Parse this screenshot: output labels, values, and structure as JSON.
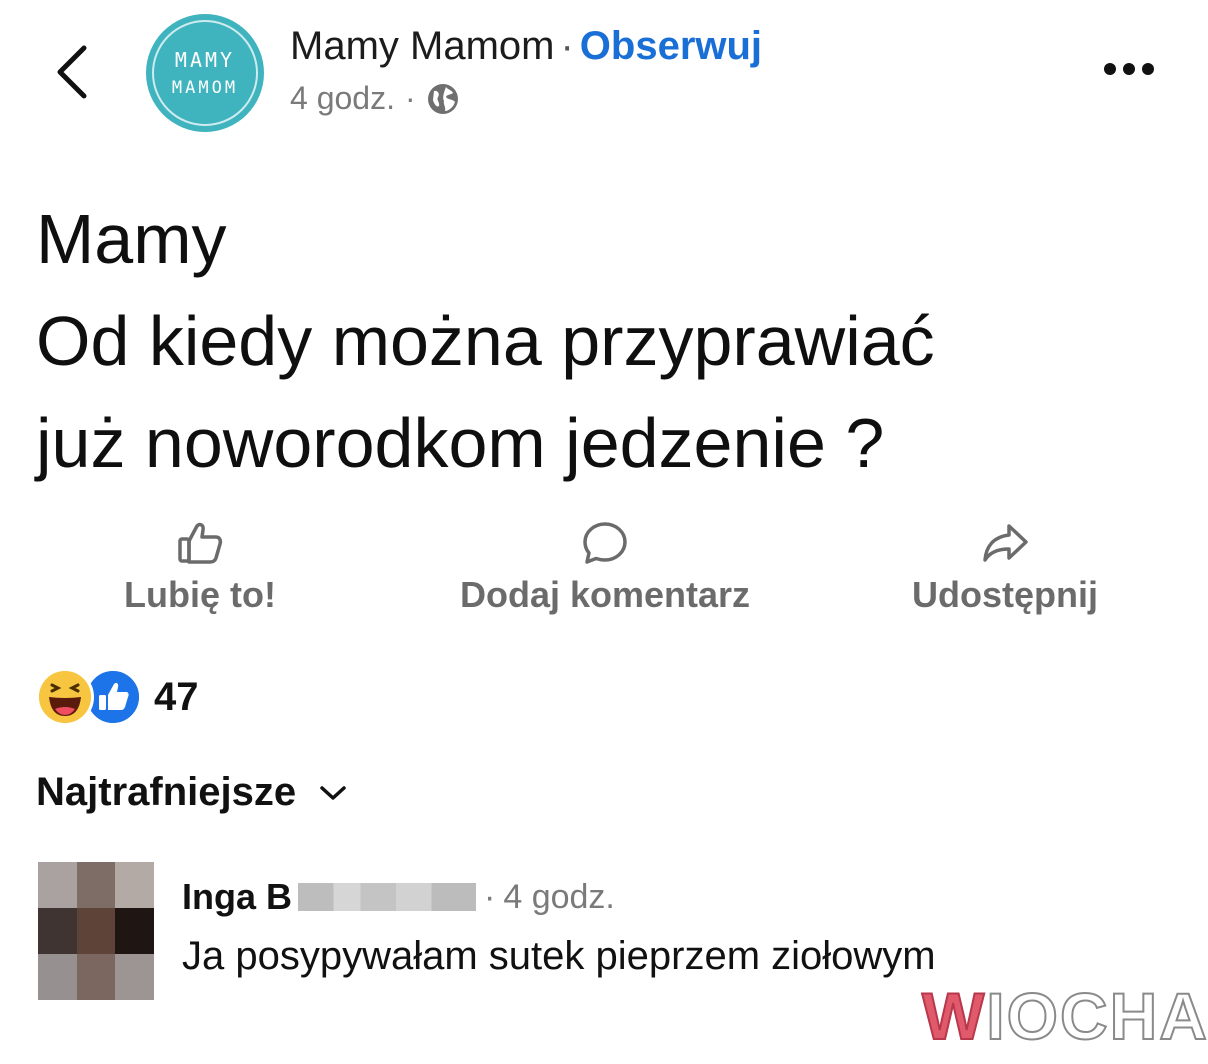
{
  "header": {
    "page_name": "Mamy Mamom",
    "separator": "·",
    "follow_label": "Obserwuj",
    "time": "4 godz.",
    "meta_dot": "·",
    "privacy_icon": "globe-icon",
    "avatar_line1": "MAMY",
    "avatar_line2": "MAMOM",
    "avatar_color": "#3fb4bf"
  },
  "post": {
    "text": "Mamy\nOd kiedy można przyprawiać\njuż noworodkom jedzenie ?"
  },
  "actions": {
    "like_label": "Lubię to!",
    "comment_label": "Dodaj komentarz",
    "share_label": "Udostępnij"
  },
  "reactions": {
    "icons": [
      "haha-emoji-icon",
      "like-reaction-icon"
    ],
    "count": "47"
  },
  "comments": {
    "sort_label": "Najtrafniejsze",
    "items": [
      {
        "author": "Inga B",
        "separator": "·",
        "time": "4 godz.",
        "text": "Ja posypywałam sutek pieprzem ziołowym"
      }
    ]
  },
  "watermark": {
    "prefix": "W",
    "rest": "IOCHA"
  },
  "colors": {
    "accent": "#1a6fd6",
    "muted": "#6b6b6b",
    "like_blue": "#1c74e8"
  }
}
